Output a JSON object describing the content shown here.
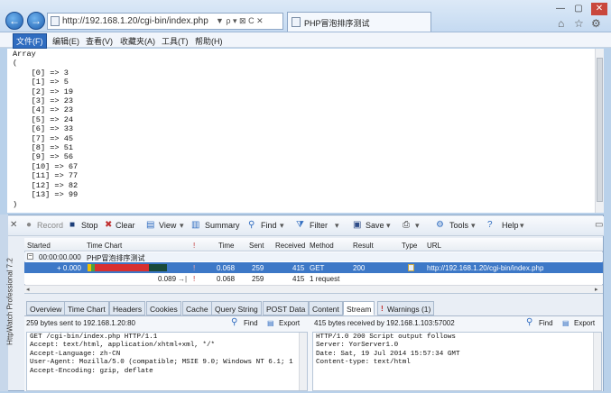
{
  "browser": {
    "url": "http://192.168.1.20/cgi-bin/index.php",
    "tab_title": "PHP冒泡排序测试",
    "back_glyph": "←",
    "forward_glyph": "→",
    "address_icons": "▼ ρ ▾ ⊠ C ✕",
    "window_controls": [
      "—",
      "▢",
      "✕"
    ],
    "toolbar_icons": [
      "⌂",
      "☆",
      "⚙"
    ]
  },
  "menu": [
    "文件(F)",
    "编辑(E)",
    "查看(V)",
    "收藏夹(A)",
    "工具(T)",
    "帮助(H)"
  ],
  "page_output": "Array\n(\n    [0] => 3\n    [1] => 5\n    [2] => 19\n    [3] => 23\n    [4] => 23\n    [5] => 24\n    [6] => 33\n    [7] => 45\n    [8] => 51\n    [9] => 56\n    [10] => 67\n    [11] => 77\n    [12] => 82\n    [13] => 99\n)",
  "httpwatch": {
    "side_label": "HttpWatch Professional 7.2",
    "toolbar": {
      "record": "Record",
      "stop": "Stop",
      "clear": "Clear",
      "view": "View",
      "summary": "Summary",
      "find": "Find",
      "filter": "Filter",
      "save": "Save",
      "tools": "Tools",
      "help": "Help"
    },
    "columns": [
      "Started",
      "Time Chart",
      "!",
      "Time",
      "Sent",
      "Received",
      "Method",
      "Result",
      "Type",
      "URL"
    ],
    "page_row": {
      "started": "00:00:00.000",
      "title": "PHP冒泡排序测试"
    },
    "request_row": {
      "started": "+ 0.000",
      "flag": "!",
      "time": "0.068",
      "sent": "259",
      "received": "415",
      "method": "GET",
      "result": "200",
      "url": "http://192.168.1.20/cgi-bin/index.php"
    },
    "summary_row": {
      "duration": "0.089",
      "flag": "!",
      "time": "0.068",
      "sent": "259",
      "received": "415",
      "requests": "1 request"
    },
    "detail_tabs": [
      "Overview",
      "Time Chart",
      "Headers",
      "Cookies",
      "Cache",
      "Query String",
      "POST Data",
      "Content",
      "Stream",
      "Warnings (1)"
    ],
    "active_tab": "Stream",
    "request_pane": {
      "header": "259 bytes sent to 192.168.1.20:80",
      "find": "Find",
      "export": "Export",
      "text": "GET /cgi-bin/index.php HTTP/1.1\nAccept: text/html, application/xhtml+xml, */*\nAccept-Language: zh-CN\nUser-Agent: Mozilla/5.0 (compatible; MSIE 9.0; Windows NT 6.1; 1\nAccept-Encoding: gzip, deflate"
    },
    "response_pane": {
      "header": "415 bytes received by 192.168.1.103:57002",
      "find": "Find",
      "export": "Export",
      "text": "HTTP/1.0 200 Script output follows\nServer: YorServer1.0\nDate: Sat, 19 Jul 2014 15:57:34 GMT\nContent-type: text/html"
    }
  }
}
